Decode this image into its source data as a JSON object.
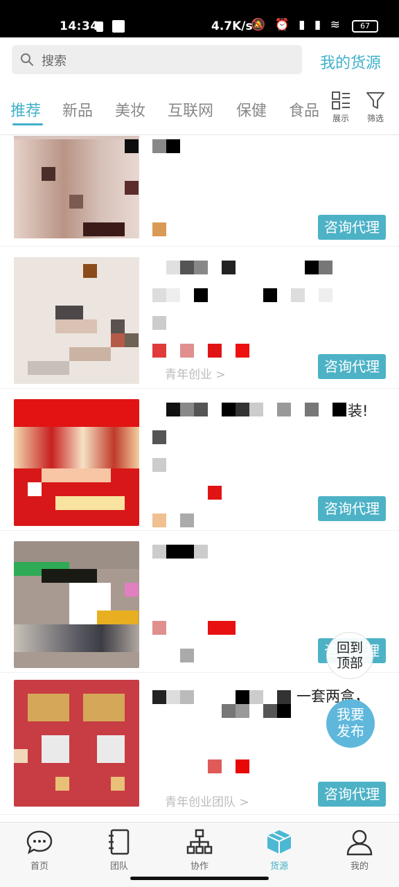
{
  "status_bar": {
    "time": "14:34",
    "speed": "4.7K/s",
    "icons": "🔕 ⏰ ▮ ▮ ≋",
    "battery": "67"
  },
  "header": {
    "search_placeholder": "搜索",
    "my_source_label": "我的货源"
  },
  "tabs": [
    {
      "label": "推荐",
      "active": true
    },
    {
      "label": "新品"
    },
    {
      "label": "美妆"
    },
    {
      "label": "互联网"
    },
    {
      "label": "保健"
    },
    {
      "label": "食品"
    }
  ],
  "tools": {
    "display_label": "展示",
    "filter_label": "筛选"
  },
  "items": [
    {
      "title_tail": "",
      "tag": "",
      "consult_label": "咨询代理"
    },
    {
      "title_tail": "",
      "tag": "青年创业 >",
      "consult_label": "咨询代理"
    },
    {
      "title_tail": "装!",
      "tag": "",
      "consult_label": "咨询代理"
    },
    {
      "title_tail": "",
      "tag": "",
      "consult_label": "咨询代理"
    },
    {
      "title_tail": "一套两盒，",
      "tag": "青年创业团队 >",
      "consult_label": "咨询代理"
    }
  ],
  "floating": {
    "back_top_line1": "回到",
    "back_top_line2": "顶部",
    "publish_line1": "我要",
    "publish_line2": "发布"
  },
  "bottom_nav": [
    {
      "label": "首页",
      "icon": "chat-icon"
    },
    {
      "label": "团队",
      "icon": "notebook-icon"
    },
    {
      "label": "协作",
      "icon": "org-chart-icon"
    },
    {
      "label": "货源",
      "icon": "box-icon",
      "active": true
    },
    {
      "label": "我的",
      "icon": "user-icon"
    }
  ],
  "colors": {
    "accent": "#3fb0c9",
    "button": "#4db2c6",
    "publish": "#5fb8dc"
  }
}
